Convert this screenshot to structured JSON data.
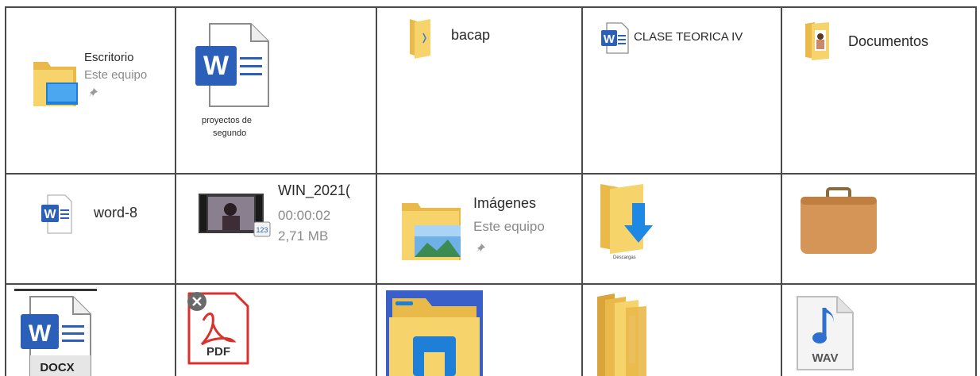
{
  "items": {
    "escritorio": {
      "name": "Escritorio",
      "location": "Este equipo",
      "icon": "desktop-folder-icon",
      "pin_icon": "pin-icon"
    },
    "proyectos": {
      "name_line1": "proyectos de",
      "name_line2": "segundo",
      "icon": "word-document-icon",
      "badge": "W"
    },
    "bacap": {
      "name": "bacap",
      "icon": "folder-icon"
    },
    "clase": {
      "name": "CLASE TEORICA IV",
      "icon": "word-document-icon",
      "badge": "W"
    },
    "documentos": {
      "name": "Documentos",
      "icon": "documents-folder-icon"
    },
    "word8": {
      "name": "word-8",
      "icon": "word-document-icon",
      "badge": "W"
    },
    "video": {
      "name": "WIN_2021(",
      "duration": "00:00:02",
      "size": "2,71 MB",
      "icon": "video-thumbnail-icon"
    },
    "imagenes": {
      "name": "Imágenes",
      "location": "Este equipo",
      "icon": "pictures-folder-icon",
      "pin_icon": "pin-icon"
    },
    "descargas": {
      "name": "Descargas",
      "icon": "downloads-folder-icon"
    },
    "briefcase": {
      "icon": "briefcase-icon"
    },
    "docx": {
      "badge": "W",
      "label": "DOCX",
      "icon": "docx-file-icon"
    },
    "pdf": {
      "label": "PDF",
      "icon": "pdf-file-icon"
    },
    "explorer": {
      "icon": "file-explorer-icon"
    },
    "folders": {
      "icon": "folder-stack-icon"
    },
    "wav": {
      "label": "WAV",
      "icon": "wav-file-icon"
    }
  },
  "colors": {
    "grid_line": "#4a4a4a",
    "folder_yellow": "#f6d36b",
    "word_blue": "#2b5fb8",
    "download_blue": "#1e88e5",
    "pdf_red": "#d9322e",
    "briefcase_brown": "#d49556"
  }
}
